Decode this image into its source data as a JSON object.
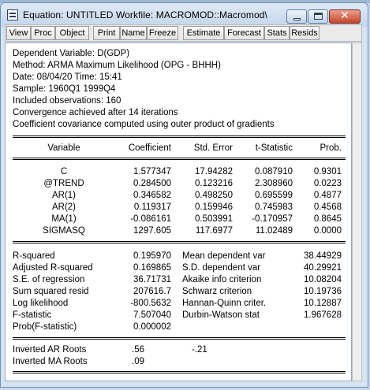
{
  "window": {
    "title": "Equation: UNTITLED   Workfile: MACROMOD::Macromod\\",
    "close_glyph": "✕"
  },
  "toolbar": {
    "buttons": [
      "View",
      "Proc",
      "Object",
      "Print",
      "Name",
      "Freeze",
      "Estimate",
      "Forecast",
      "Stats",
      "Resids"
    ]
  },
  "header": {
    "dependent": "Dependent Variable: D(GDP)",
    "method": "Method: ARMA Maximum Likelihood (OPG - BHHH)",
    "date": "Date: 08/04/20   Time: 15:41",
    "sample": "Sample: 1960Q1 1999Q4",
    "observations": "Included observations: 160",
    "convergence": "Convergence achieved after 14 iterations",
    "covariance": "Coefficient covariance computed using outer product of gradients"
  },
  "coef_table": {
    "columns": [
      "Variable",
      "Coefficient",
      "Std. Error",
      "t-Statistic",
      "Prob."
    ],
    "rows": [
      [
        "C",
        "1.577347",
        "17.94282",
        "0.087910",
        "0.9301"
      ],
      [
        "@TREND",
        "0.284500",
        "0.123216",
        "2.308960",
        "0.0223"
      ],
      [
        "AR(1)",
        "0.346582",
        "0.498250",
        "0.695599",
        "0.4877"
      ],
      [
        "AR(2)",
        "0.119317",
        "0.159946",
        "0.745983",
        "0.4568"
      ],
      [
        "MA(1)",
        "-0.086161",
        "0.503991",
        "-0.170957",
        "0.8645"
      ],
      [
        "SIGMASQ",
        "1297.605",
        "117.6977",
        "11.02489",
        "0.0000"
      ]
    ]
  },
  "stats": {
    "left": [
      [
        "R-squared",
        "0.195970"
      ],
      [
        "Adjusted R-squared",
        "0.169865"
      ],
      [
        "S.E. of regression",
        "36.71731"
      ],
      [
        "Sum squared resid",
        "207616.7"
      ],
      [
        "Log likelihood",
        "-800.5632"
      ],
      [
        "F-statistic",
        "7.507040"
      ],
      [
        "Prob(F-statistic)",
        "0.000002"
      ]
    ],
    "right": [
      [
        "Mean dependent var",
        "38.44929"
      ],
      [
        "S.D. dependent var",
        "40.29921"
      ],
      [
        "Akaike info criterion",
        "10.08204"
      ],
      [
        "Schwarz criterion",
        "10.19736"
      ],
      [
        "Hannan-Quinn criter.",
        "10.12887"
      ],
      [
        "Durbin-Watson stat",
        "1.967628"
      ]
    ]
  },
  "roots": {
    "ar_label": "Inverted AR Roots",
    "ar_values": [
      ".56",
      "-.21"
    ],
    "ma_label": "Inverted MA Roots",
    "ma_values": [
      ".09"
    ]
  }
}
